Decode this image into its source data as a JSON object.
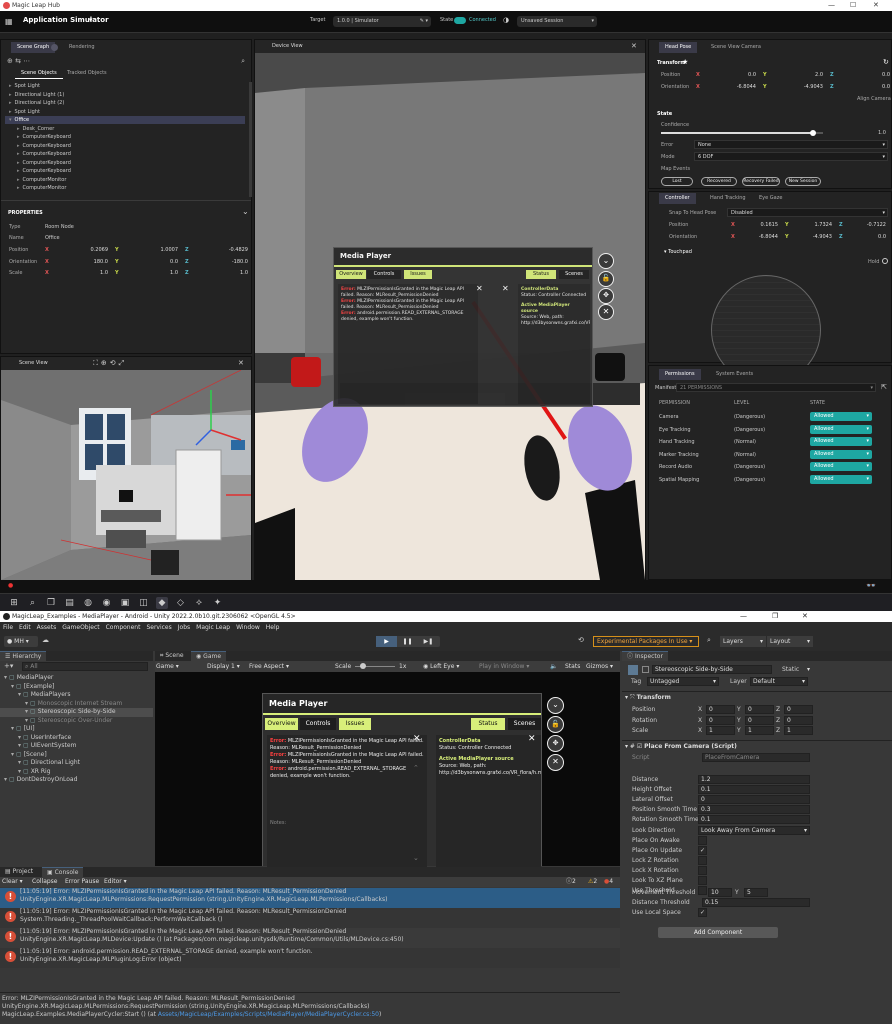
{
  "hub": {
    "window_title": "Magic Leap Hub",
    "app_title": "Application Simulator",
    "target_label": "Target",
    "target_value": "1.0.0 | Simulator",
    "state_label": "State",
    "state_value": "Connected",
    "session_value": "Unsaved Session",
    "scene_graph": {
      "tabs": [
        "Scene Graph",
        "Rendering"
      ],
      "subtabs": [
        "Scene Objects",
        "Tracked Objects"
      ],
      "items": [
        {
          "label": "Spot Light",
          "indent": 1
        },
        {
          "label": "Directional Light (1)",
          "indent": 1
        },
        {
          "label": "Directional Light (2)",
          "indent": 1
        },
        {
          "label": "Spot Light",
          "indent": 1
        },
        {
          "label": "Office",
          "indent": 1,
          "selected": true
        },
        {
          "label": "Desk_Corner",
          "indent": 2
        },
        {
          "label": "ComputerKeyboard",
          "indent": 2
        },
        {
          "label": "ComputerKeyboard",
          "indent": 2
        },
        {
          "label": "ComputerKeyboard",
          "indent": 2
        },
        {
          "label": "ComputerKeyboard",
          "indent": 2
        },
        {
          "label": "ComputerKeyboard",
          "indent": 2
        },
        {
          "label": "ComputerMonitor",
          "indent": 2
        },
        {
          "label": "ComputerMonitor",
          "indent": 2
        }
      ],
      "properties_title": "PROPERTIES",
      "type_label": "Type",
      "type_value": "Room Node",
      "name_label": "Name",
      "name_value": "Office",
      "position_label": "Position",
      "position": [
        "0.2069",
        "1.0007",
        "-0.4829"
      ],
      "orientation_label": "Orientation",
      "orientation": [
        "180.0",
        "0.0",
        "-180.0"
      ],
      "scale_label": "Scale",
      "scale": [
        "1.0",
        "1.0",
        "1.0"
      ]
    },
    "scene_view_title": "Scene View",
    "device_view_title": "Device View",
    "head_pose": {
      "tabs": [
        "Head Pose",
        "Scene View Camera"
      ],
      "transform_label": "Transform",
      "position_label": "Position",
      "position": [
        "0.0",
        "2.0",
        "0.0"
      ],
      "orientation_label": "Orientation",
      "orientation": [
        "-6.8044",
        "-4.9043",
        "0.0"
      ],
      "align_label": "Align Camera",
      "state_label": "State",
      "confidence_label": "Confidence",
      "confidence_value": "1.0",
      "confidence_fraction": 0.94,
      "error_label": "Error",
      "error_value": "None",
      "mode_label": "Mode",
      "mode_value": "6 DOF",
      "map_events_label": "Map Events",
      "events": [
        "Lost",
        "Recovered",
        "Recovery Failed",
        "New Session"
      ]
    },
    "controller": {
      "tabs": [
        "Controller",
        "Hand Tracking",
        "Eye Gaze"
      ],
      "snap_label": "Snap To Head Pose",
      "snap_value": "Disabled",
      "position_label": "Position",
      "position": [
        "0.1615",
        "1.7324",
        "-0.7122"
      ],
      "orientation_label": "Orientation",
      "orientation": [
        "-6.8044",
        "-4.9043",
        "0.0"
      ],
      "touchpad_label": "Touchpad",
      "hold_label": "Hold"
    },
    "permissions": {
      "tabs": [
        "Permissions",
        "System Events"
      ],
      "manifest_label": "Manifest",
      "manifest_value": "21 PERMISSIONS",
      "col_permission": "PERMISSION",
      "col_level": "LEVEL",
      "col_state": "STATE",
      "rows": [
        {
          "name": "Camera",
          "level": "(Dangerous)",
          "state": "Allowed"
        },
        {
          "name": "Eye Tracking",
          "level": "(Dangerous)",
          "state": "Allowed"
        },
        {
          "name": "Hand Tracking",
          "level": "(Normal)",
          "state": "Allowed"
        },
        {
          "name": "Marker Tracking",
          "level": "(Normal)",
          "state": "Allowed"
        },
        {
          "name": "Record Audio",
          "level": "(Dangerous)",
          "state": "Allowed"
        },
        {
          "name": "Spatial Mapping",
          "level": "(Dangerous)",
          "state": "Allowed"
        }
      ]
    }
  },
  "media_player": {
    "title": "Media Player",
    "tabs": [
      "Overview",
      "Controls",
      "Issues"
    ],
    "tabs_right": [
      "Status",
      "Scenes"
    ],
    "error_prefix": "Error:",
    "log_lines": [
      "MLZIPermissionIsGranted in the Magic Leap API failed. Reason: MLResult_PermissionDenied",
      "MLZIPermissionIsGranted in the Magic Leap API failed. Reason: MLResult_PermissionDenied",
      "android.permission.READ_EXTERNAL_STORAGE denied, example won't function."
    ],
    "controller_data_title": "ControllerData",
    "controller_data_value": "Status: Controller Connected",
    "active_source_title": "Active MediaPlayer source",
    "active_source_value": "Source: Web, path: http://d3bysonwns.grafxi.co/VR_flora/h.mp4",
    "notes_label": "Notes:"
  },
  "taskbar": {
    "icons": [
      "windows-icon",
      "search-icon",
      "task-view-icon",
      "explorer-icon",
      "edge-icon",
      "chrome-icon",
      "terminal-icon",
      "store-icon",
      "unity-icon",
      "unity-hub-icon",
      "vscode-icon",
      "magicleap-icon"
    ]
  },
  "unity": {
    "window_title": "MagicLeap_Examples - MediaPlayer - Android - Unity 2022.2.0b10.git.2306062 <OpenGL 4.5>",
    "menu": [
      "File",
      "Edit",
      "Assets",
      "GameObject",
      "Component",
      "Services",
      "Jobs",
      "Magic Leap",
      "Window",
      "Help"
    ],
    "account": "MH",
    "exp_packages": "Experimental Packages In Use",
    "layers": "Layers",
    "layout": "Layout",
    "hierarchy_title": "Hierarchy",
    "hierarchy_search": "All",
    "hierarchy": [
      {
        "label": "MediaPlayer",
        "indent": 0
      },
      {
        "label": "[Example]",
        "indent": 1
      },
      {
        "label": "MediaPlayers",
        "indent": 2
      },
      {
        "label": "Monoscopic Internet Stream",
        "indent": 3,
        "dim": true
      },
      {
        "label": "Stereoscopic Side-by-Side",
        "indent": 3,
        "selected": true
      },
      {
        "label": "Stereoscopic Over-Under",
        "indent": 3,
        "dim": true
      },
      {
        "label": "[UI]",
        "indent": 1
      },
      {
        "label": "UserInterface",
        "indent": 2
      },
      {
        "label": "UIEventSystem",
        "indent": 2
      },
      {
        "label": "[Scene]",
        "indent": 1
      },
      {
        "label": "Directional Light",
        "indent": 2
      },
      {
        "label": "XR Rig",
        "indent": 2
      },
      {
        "label": "DontDestroyOnLoad",
        "indent": 0
      }
    ],
    "scene_tab": "Scene",
    "game_tab": "Game",
    "game_bar": {
      "mode": "Game",
      "display": "Display 1",
      "aspect": "Free Aspect",
      "scale_label": "Scale",
      "scale_value": "1x",
      "eye": "Left Eye",
      "play_in": "Play in Window",
      "stats": "Stats",
      "gizmos": "Gizmos"
    },
    "console": {
      "tabs": [
        "Project",
        "Console"
      ],
      "buttons": [
        "Clear",
        "Collapse",
        "Error Pause",
        "Editor"
      ],
      "counts": [
        "2",
        "2",
        "4"
      ],
      "entries": [
        {
          "line1": "[11:05:19] Error: MLZIPermissionIsGranted in the Magic Leap API failed. Reason: MLResult_PermissionDenied",
          "line2": "UnityEngine.XR.MagicLeap.MLPermissions:RequestPermission (string,UnityEngine.XR.MagicLeap.MLPermissions/Callbacks)",
          "selected": true
        },
        {
          "line1": "[11:05:19] Error: MLZIPermissionIsGranted in the Magic Leap API failed. Reason: MLResult_PermissionDenied",
          "line2": "System.Threading._ThreadPoolWaitCallback:PerformWaitCallback ()"
        },
        {
          "line1": "[11:05:19] Error: MLZIPermissionIsGranted in the Magic Leap API failed. Reason: MLResult_PermissionDenied",
          "line2": "UnityEngine.XR.MagicLeap.MLDevice:Update () (at Packages/com.magicleap.unitysdk/Runtime/Common/Utils/MLDevice.cs:450)"
        },
        {
          "line1": "[11:05:19] Error: android.permission.READ_EXTERNAL_STORAGE denied, example won't function.",
          "line2": "UnityEngine.XR.MagicLeap.MLPluginLog:Error (object)"
        }
      ],
      "detail": [
        "Error: MLZIPermissionIsGranted in the Magic Leap API failed. Reason: MLResult_PermissionDenied",
        "UnityEngine.XR.MagicLeap.MLPermissions:RequestPermission (string,UnityEngine.XR.MagicLeap.MLPermissions/Callbacks)",
        "MagicLeap.Examples.MediaPlayerCycler:Start () (at "
      ],
      "detail_link": "Assets/MagicLeap/Examples/Scripts/MediaPlayer/MediaPlayerCycler.cs:50",
      "detail_end": ")"
    },
    "inspector": {
      "title": "Inspector",
      "object_name": "Stereoscopic Side-by-Side",
      "static_label": "Static",
      "tag_label": "Tag",
      "tag_value": "Untagged",
      "layer_label": "Layer",
      "layer_value": "Default",
      "transform_title": "Transform",
      "position_label": "Position",
      "position": [
        "0",
        "0",
        "0"
      ],
      "rotation_label": "Rotation",
      "rotation": [
        "0",
        "0",
        "0"
      ],
      "scale_label": "Scale",
      "scale": [
        "1",
        "1",
        "1"
      ],
      "component_title": "Place From Camera (Script)",
      "script_label": "Script",
      "script_value": "PlaceFromCamera",
      "fields": [
        {
          "label": "Distance",
          "value": "1.2"
        },
        {
          "label": "Height Offset",
          "value": "0.1"
        },
        {
          "label": "Lateral Offset",
          "value": "0"
        },
        {
          "label": "Position Smooth Time",
          "value": "0.3"
        },
        {
          "label": "Rotation Smooth Time",
          "value": "0.1"
        },
        {
          "label": "Look Direction",
          "value": "Look Away From Camera"
        },
        {
          "label": "Place On Awake",
          "value": ""
        },
        {
          "label": "Place On Update",
          "value": "✓"
        },
        {
          "label": "Lock Z Rotation",
          "value": ""
        },
        {
          "label": "Lock X Rotation",
          "value": ""
        },
        {
          "label": "Look To XZ Plane",
          "value": ""
        },
        {
          "label": "Use Threshold",
          "value": ""
        }
      ],
      "movement_label": "Movement Threshold",
      "movement": [
        "10",
        "5"
      ],
      "distance_threshold_label": "Distance Threshold",
      "distance_threshold": "0.15",
      "use_local_label": "Use Local Space",
      "use_local": "✓",
      "add_component": "Add Component"
    }
  },
  "colors": {
    "accent_green": "#d8ef7a",
    "error_red": "#d84f38",
    "allowed_teal": "#1ea7a2",
    "axis_x": "#e05555",
    "axis_y": "#c6d84a",
    "axis_z": "#57b8c8"
  }
}
